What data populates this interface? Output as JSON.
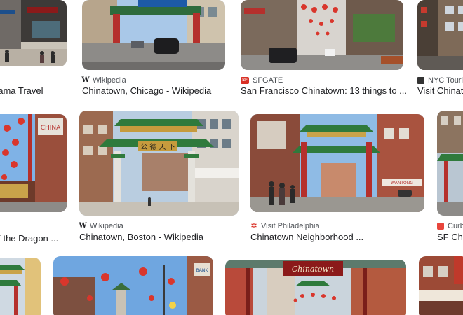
{
  "results": [
    {
      "title": "hama Travel",
      "source": "",
      "icon": "none"
    },
    {
      "title": "Chinatown, Chicago - Wikipedia",
      "source": "Wikipedia",
      "icon": "wikipedia-icon"
    },
    {
      "title": "San Francisco Chinatown: 13 things to ...",
      "source": "SFGATE",
      "icon": "sfgate-icon"
    },
    {
      "title": "Visit Chinato",
      "source": "NYC Touris",
      "icon": "nyc-tourism-icon"
    },
    {
      "title": "of the Dragon ...",
      "source": "",
      "icon": "none"
    },
    {
      "title": "Chinatown, Boston - Wikipedia",
      "source": "Wikipedia",
      "icon": "wikipedia-icon"
    },
    {
      "title": "Chinatown Neighborhood ...",
      "source": "Visit Philadelphia",
      "icon": "visit-philadelphia-icon"
    },
    {
      "title": "SF Ch",
      "source": "Curb",
      "icon": "curbed-icon"
    }
  ],
  "signs": {
    "gate_sign": "公 德 天 下",
    "chinatown_sign": "Chinatown",
    "dragon_sign": "CHINA",
    "bank_sign": "BANK",
    "boston_shop": " ",
    "philly_shop": "WANTONG"
  },
  "colors": {
    "sky": "#7fb2e6",
    "gate_green": "#2f7a3c",
    "gate_red": "#b5302c",
    "lantern": "#d9362c",
    "brick": "#8a4b3a"
  }
}
